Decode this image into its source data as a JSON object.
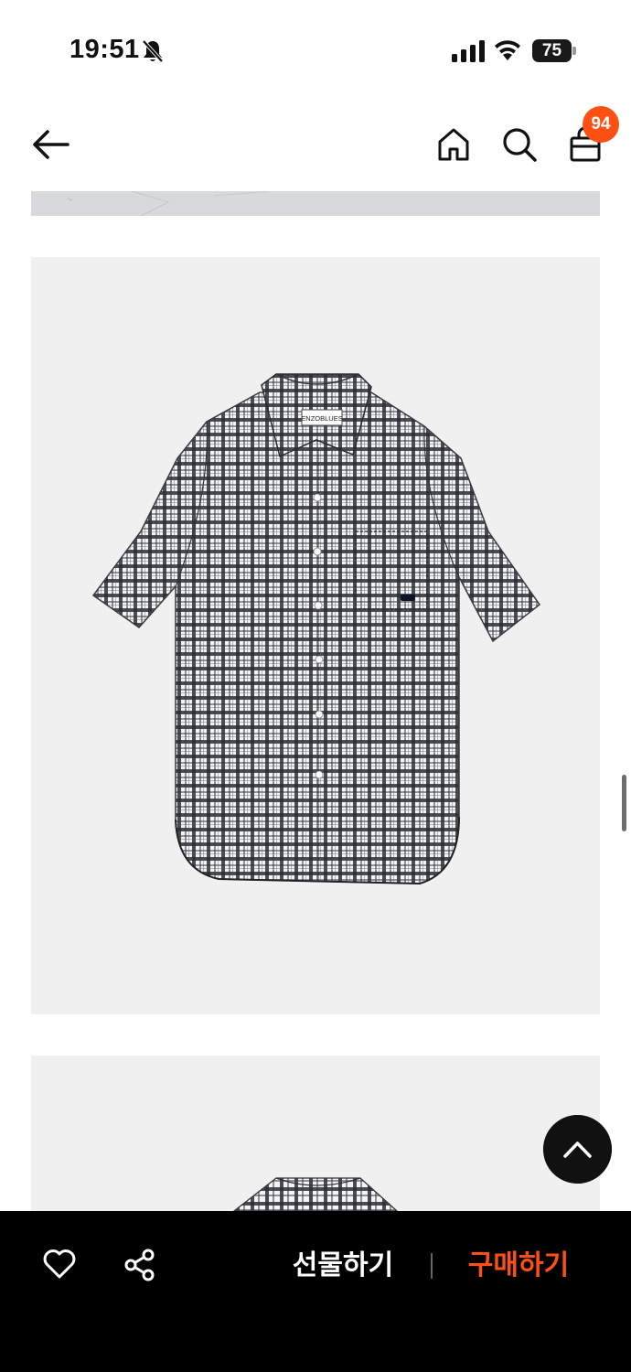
{
  "status_bar": {
    "time": "19:51",
    "battery_level": "75",
    "icons": [
      "bell-off-icon",
      "cellular-signal-icon",
      "wifi-icon",
      "battery-icon"
    ]
  },
  "nav": {
    "icons": [
      "back-arrow-icon",
      "home-icon",
      "search-icon",
      "shopping-bag-icon"
    ],
    "cart_count": "94"
  },
  "product": {
    "shirt_tag_text": "ENZOBLUES",
    "accent_color": "#ff4f12"
  },
  "bottom_bar": {
    "like_icon": "heart-icon",
    "share_icon": "share-icon",
    "gift_label": "선물하기",
    "buy_label": "구매하기"
  }
}
